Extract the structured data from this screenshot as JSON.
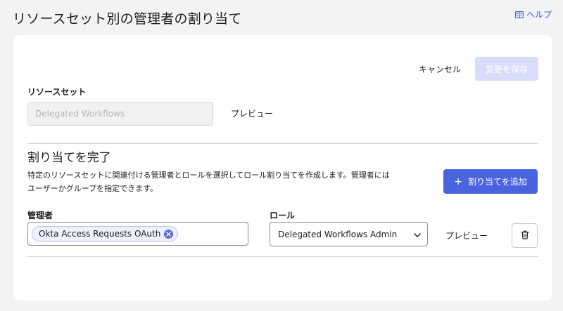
{
  "header": {
    "title": "リソースセット別の管理者の割り当て",
    "help_label": "ヘルプ"
  },
  "toolbar": {
    "cancel_label": "キャンセル",
    "save_label": "変更を保存"
  },
  "resource_set": {
    "label": "リソースセット",
    "value": "Delegated Workflows",
    "preview_label": "プレビュー"
  },
  "assignment": {
    "title": "割り当てを完了",
    "description_line1": "特定のリソースセットに関連付ける管理者とロールを選択してロール割り当てを作成します。管理者には",
    "description_line2": "ユーザーかグループを指定できます。",
    "add_button_label": "割り当てを追加",
    "admin_label": "管理者",
    "admin_chip": "Okta Access Requests OAuth",
    "role_label": "ロール",
    "role_value": "Delegated Workflows Admin",
    "row_preview_label": "プレビュー"
  },
  "icons": {
    "help": "book-icon",
    "add": "plus-icon",
    "remove_chip": "close-circle-icon",
    "role_dropdown": "chevron-down-icon",
    "delete": "trash-icon"
  },
  "colors": {
    "accent": "#4a64e0",
    "save_disabled": "#d8def9",
    "link": "#3f59e4"
  }
}
